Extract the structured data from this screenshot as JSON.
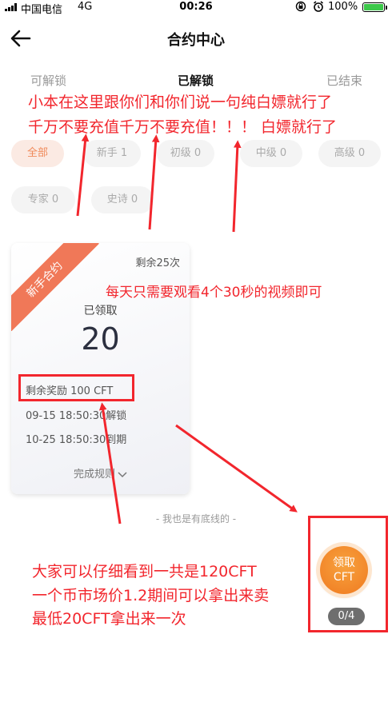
{
  "status_bar": {
    "carrier": "中国电信",
    "network": "4G",
    "time": "00:26",
    "battery": "100%"
  },
  "header": {
    "title": "合约中心"
  },
  "tabs": [
    {
      "label": "可解锁"
    },
    {
      "label": "已解锁"
    },
    {
      "label": "已结束"
    }
  ],
  "filters": [
    {
      "label": "全部"
    },
    {
      "label": "新手 1"
    },
    {
      "label": "初级 0"
    },
    {
      "label": "中级 0"
    },
    {
      "label": "高级 0"
    },
    {
      "label": "专家 0"
    },
    {
      "label": "史诗 0"
    }
  ],
  "card": {
    "ribbon": "新手合约",
    "remaining": "剩余25次",
    "received_label": "已领取",
    "received_value": "20",
    "reward": "剩余奖励 100 CFT",
    "unlock_time": "09-15 18:50:30解锁",
    "expire_time": "10-25 18:50:30到期",
    "rules_label": "完成规则"
  },
  "bottom_line": "- 我也是有底线的 -",
  "claim": {
    "label_line1": "领取",
    "label_line2": "CFT",
    "count": "0/4"
  },
  "annotations": {
    "line1": "小本在这里跟你们和你们说一句纯白嫖就行了",
    "line2": "千万不要充值千万不要充值！！！ 白嫖就行了",
    "middle": "每天只需要观看4个30秒的视频即可",
    "bottom1": "大家可以仔细看到一共是120CFT",
    "bottom2": "一个币市场价1.2期间可以拿出来卖",
    "bottom3": "最低20CFT拿出来一次"
  },
  "colors": {
    "annotation_red": "#f2262d",
    "accent_orange": "#f07a20",
    "ribbon": "#f07858",
    "chip_active_bg": "#fbeae3"
  }
}
